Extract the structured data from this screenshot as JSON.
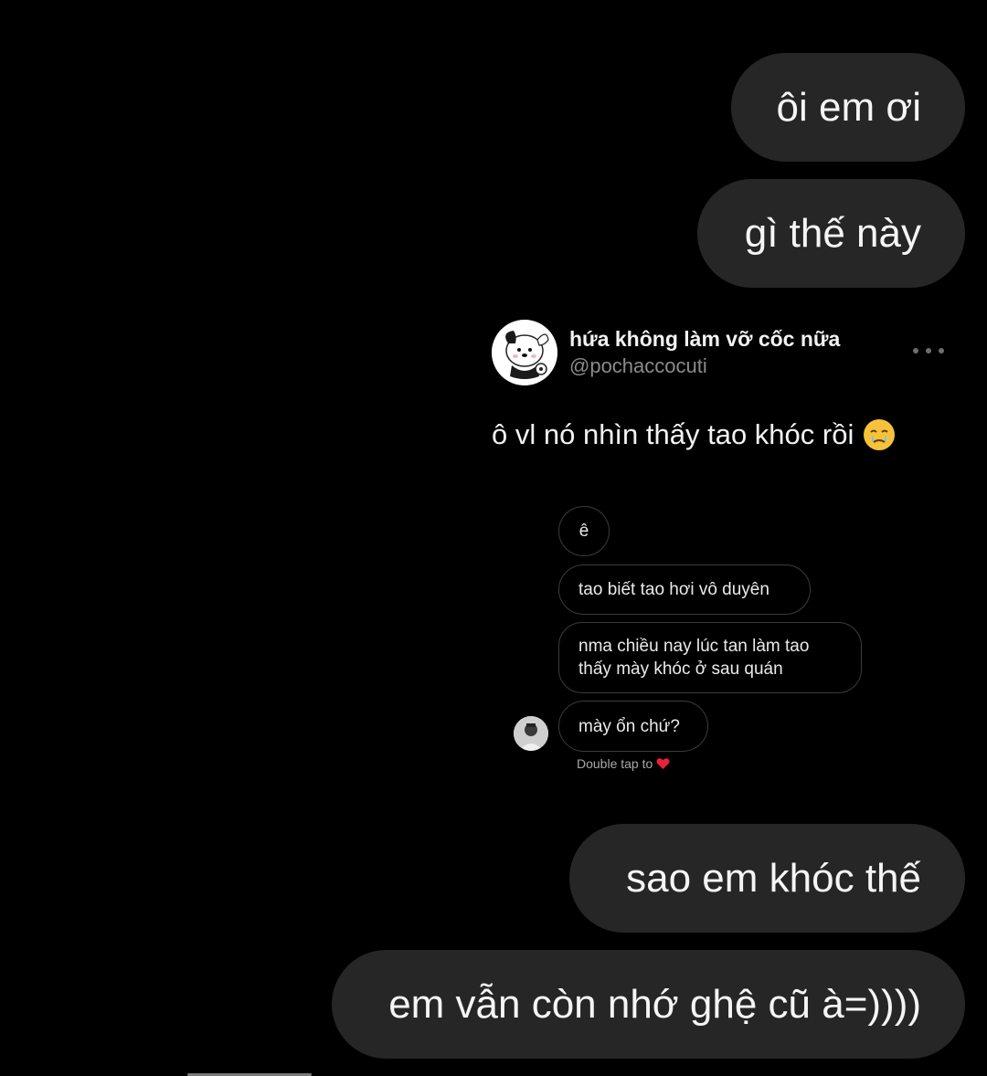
{
  "messages_sent": {
    "m1": "ôi em ơi",
    "m2": "gì thế này",
    "m3": "sao em khóc thế",
    "m4": "em vẫn còn nhớ ghệ cũ à=))))"
  },
  "tweet": {
    "display_name": "hứa không làm vỡ cốc nữa",
    "handle": "@pochaccocuti",
    "text": "ô vl nó nhìn thấy tao khóc rồi",
    "emoji": "face-holding-back-tears-icon",
    "avatar": "pochacco-avatar-icon",
    "more": "more-options-icon",
    "embedded_dm": {
      "messages": {
        "d1": "ê",
        "d2": "tao biết tao hơi vô duyên",
        "d3_line1": "nma chiều nay lúc tan làm tao",
        "d3_line2": "thấy mày khóc ở sau quán",
        "d4": "mày ổn chứ?"
      },
      "double_tap_hint": "Double tap to",
      "heart_color": "#e8223a"
    }
  },
  "colors": {
    "background": "#000000",
    "bubble": "#262626",
    "dm_border": "#3c3c3c"
  }
}
